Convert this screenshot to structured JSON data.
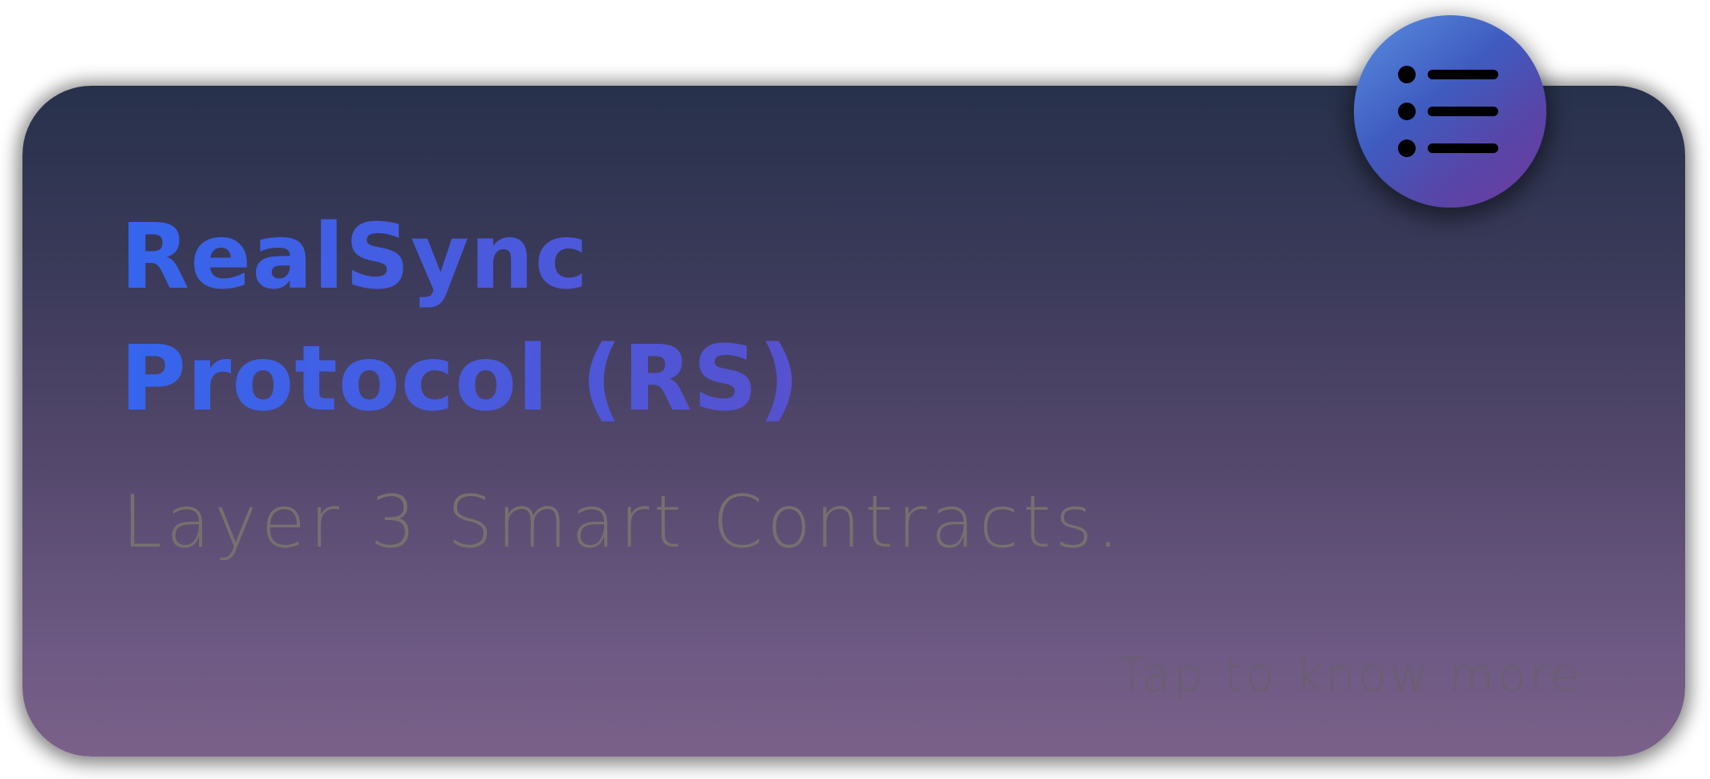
{
  "card": {
    "title_line1": "RealSync",
    "title_line2": "Protocol (RS)",
    "subtitle": "Layer 3 Smart Contracts.",
    "cta": "Tap to know more"
  },
  "menu_button": {
    "icon": "list-icon"
  },
  "colors": {
    "card_top": "#27314b",
    "card_bottom": "#7a6189",
    "title_start": "#3566ee",
    "title_end": "#5e4cc6",
    "subtitle": "#76706f",
    "menu_button_start": "#5a8fe0",
    "menu_button_end": "#6f3aa0"
  }
}
